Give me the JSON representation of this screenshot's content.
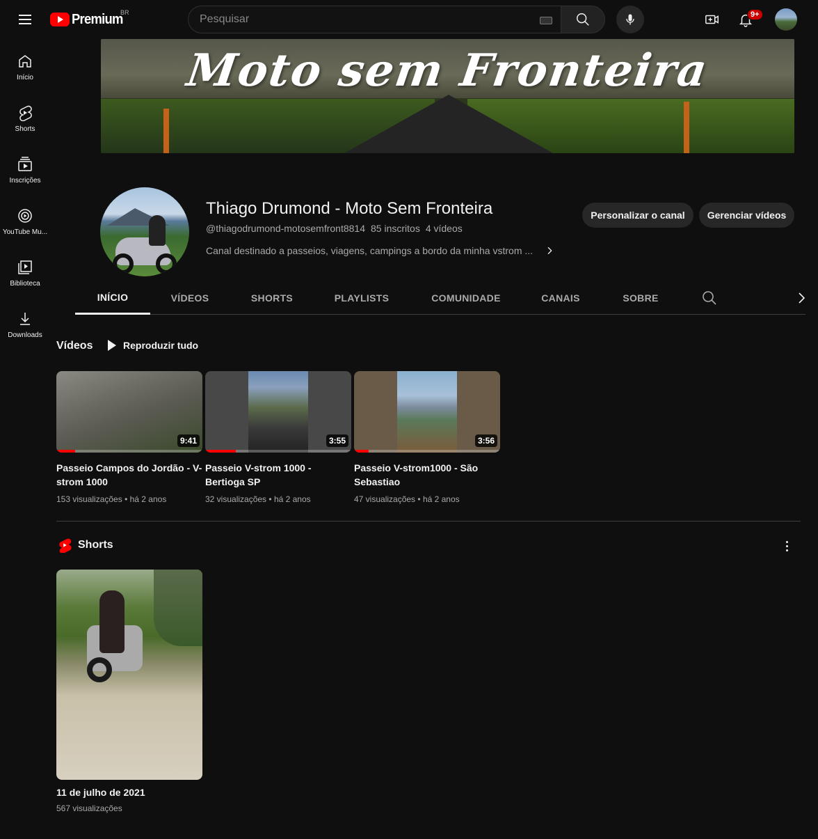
{
  "topbar": {
    "logo_text": "Premium",
    "country": "BR",
    "search_placeholder": "Pesquisar",
    "notification_count": "9+"
  },
  "sidebar": {
    "items": [
      {
        "label": "Início",
        "icon": "home-icon"
      },
      {
        "label": "Shorts",
        "icon": "shorts-icon"
      },
      {
        "label": "Inscrições",
        "icon": "subscriptions-icon"
      },
      {
        "label": "YouTube Mu...",
        "icon": "youtube-music-icon"
      },
      {
        "label": "Biblioteca",
        "icon": "library-icon"
      },
      {
        "label": "Downloads",
        "icon": "download-icon"
      }
    ]
  },
  "banner": {
    "title": "Moto sem Fronteira"
  },
  "channel": {
    "name": "Thiago Drumond - Moto Sem Fronteira",
    "handle": "@thiagodrumond-motosemfront8814",
    "subscribers": "85 inscritos",
    "videos_count": "4 vídeos",
    "description": "Canal destinado a passeios, viagens, campings a bordo da minha vstrom ...",
    "customize_label": "Personalizar o canal",
    "manage_label": "Gerenciar vídeos"
  },
  "tabs": [
    {
      "label": "INÍCIO",
      "active": true
    },
    {
      "label": "VÍDEOS"
    },
    {
      "label": "SHORTS"
    },
    {
      "label": "PLAYLISTS"
    },
    {
      "label": "COMUNIDADE"
    },
    {
      "label": "CANAIS"
    },
    {
      "label": "SOBRE"
    }
  ],
  "videos_section": {
    "title": "Vídeos",
    "play_all": "Reproduzir tudo",
    "items": [
      {
        "title": "Passeio Campos do Jordão - V-strom 1000",
        "duration": "9:41",
        "views": "153 visualizações",
        "age": "há 2 anos",
        "watched_fraction": 0.13
      },
      {
        "title": "Passeio V-strom 1000 - Bertioga SP",
        "duration": "3:55",
        "views": "32 visualizações",
        "age": "há 2 anos",
        "watched_fraction": 0.21
      },
      {
        "title": "Passeio V-strom1000 - São Sebastiao",
        "duration": "3:56",
        "views": "47 visualizações",
        "age": "há 2 anos",
        "watched_fraction": 0.1
      }
    ]
  },
  "shorts_section": {
    "title": "Shorts",
    "items": [
      {
        "title": "11 de julho de 2021",
        "views": "567 visualizações"
      }
    ]
  },
  "colors": {
    "background": "#0f0f0f",
    "accent": "#ff0000",
    "text_primary": "#f1f1f1",
    "text_secondary": "#aaaaaa"
  }
}
